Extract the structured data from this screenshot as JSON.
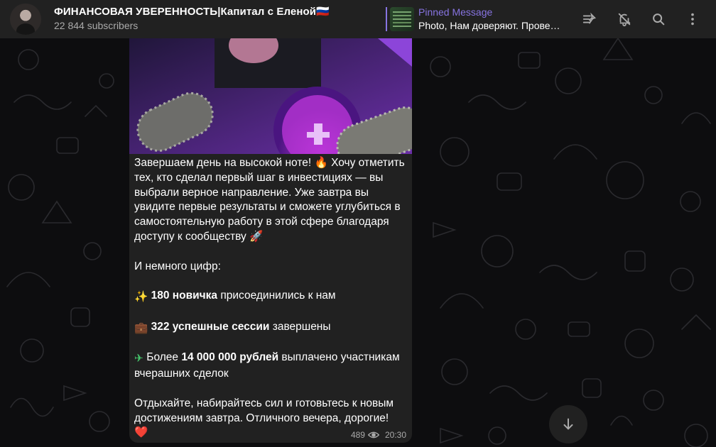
{
  "header": {
    "title": "ФИНАНСОВАЯ УВЕРЕННОСТЬ|Капитал с Еленой🇷🇺",
    "subscribers": "22 844 subscribers",
    "pinned_label": "Pinned Message",
    "pinned_text": "Photo, Нам доверяют. Прове…"
  },
  "message": {
    "lines": [
      {
        "t": "Завершаем день на высокой ноте! 🔥 Хочу отметить тех, кто сделал первый шаг в инвестициях — вы выбрали верное направление. Уже завтра вы увидите первые результаты и сможете углубиться в самостоятельную работу в этой сфере благодаря доступу к сообществу 🚀"
      },
      {
        "t": "И немного цифр:"
      }
    ],
    "stat1_icon": "✨",
    "stat1_bold": "180 новичка",
    "stat1_rest": " присоединились к нам",
    "stat2_icon": "💼",
    "stat2_bold": "322 успешные сессии",
    "stat2_rest": " завершены",
    "stat3_icon": "✈",
    "stat3_pre": " Более ",
    "stat3_bold": "14 000 000 рублей",
    "stat3_rest": " выплачено участникам вчерашних сделок",
    "closing": "Отдыхайте, набирайтесь сил и готовьтесь к новым достижениям завтра. Отличного вечера, дорогие!",
    "closing_emoji": "❤️",
    "views": "489",
    "time": "20:30"
  },
  "icons": {
    "pinned_list": "pinned-list-icon",
    "mute": "bell-off-icon",
    "search": "search-icon",
    "more": "more-vertical-icon",
    "scroll": "arrow-down-icon",
    "views": "eye-icon"
  },
  "colors": {
    "accent": "#8774e1",
    "header_bg": "#212121",
    "bubble_bg": "#212121",
    "secondary_text": "#aaaaaa"
  }
}
